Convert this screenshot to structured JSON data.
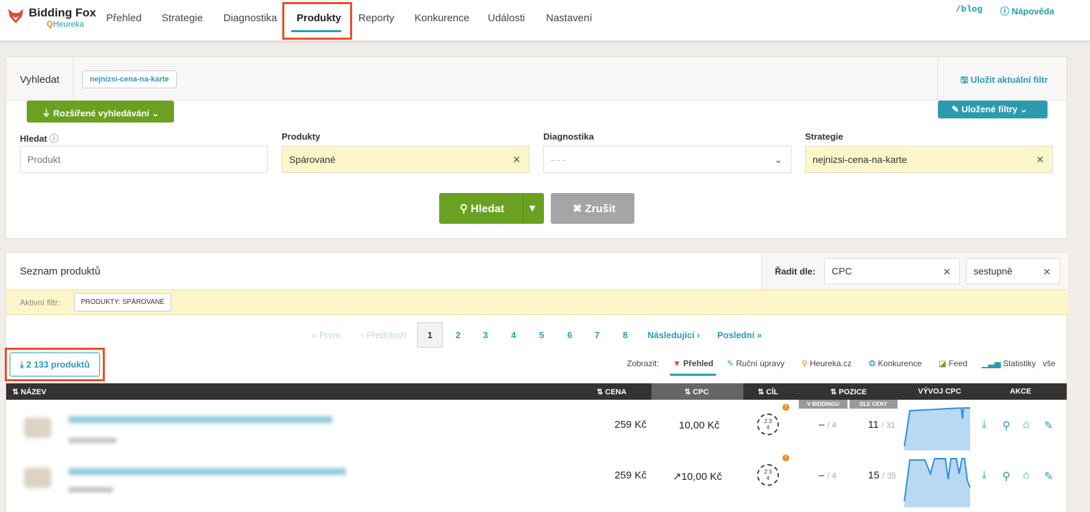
{
  "app": {
    "name": "Bidding Fox",
    "sub": "Heureka"
  },
  "nav": {
    "items": [
      "Přehled",
      "Strategie",
      "Diagnostika",
      "Produkty",
      "Reporty",
      "Konkurence",
      "Události",
      "Nastavení"
    ],
    "blog": "/blog",
    "help": "Nápověda"
  },
  "search": {
    "title": "Vyhledat",
    "tag": "nejnizsi-cena-na-karte",
    "save_filter": "Uložit aktuální filtr",
    "advanced": "Rozšířené vyhledávání",
    "saved_filters": "Uložené filtry",
    "labels": {
      "hledat": "Hledat",
      "produkty": "Produkty",
      "diagnostika": "Diagnostika",
      "strategie": "Strategie"
    },
    "product_placeholder": "Produkt",
    "produkty_value": "Spárované",
    "diagnostika_value": "- - -",
    "strategie_value": "nejnizsi-cena-na-karte",
    "search_btn": "Hledat",
    "cancel_btn": "Zrušit"
  },
  "list": {
    "title": "Seznam produktů",
    "sort_label": "Řadit dle:",
    "sort_value": "CPC",
    "sort_dir": "sestupně",
    "active_filter_label": "Aktivní filtr:",
    "active_filter": "PRODUKTY: SPÁROVANÉ",
    "count_btn": "2 133 produktů"
  },
  "pagination": {
    "first": "« První",
    "prev": "‹ Předchozí",
    "pages": [
      "1",
      "2",
      "3",
      "4",
      "5",
      "6",
      "7",
      "8"
    ],
    "current": "1",
    "next": "Následující ›",
    "last": "Poslední »"
  },
  "show": {
    "label": "Zobrazit:",
    "items": [
      "Přehled",
      "Ruční úpravy",
      "Heureka.cz",
      "Konkurence",
      "Feed",
      "Statistiky",
      "vše"
    ]
  },
  "table": {
    "headers": {
      "name": "NÁZEV",
      "price": "CENA",
      "cpc": "CPC",
      "goal": "CÍL",
      "position": "POZICE",
      "cpc_trend": "VÝVOJ CPC",
      "actions": "AKCE"
    },
    "subheaders": {
      "bidding": "V BIDDINGU",
      "by_price": "DLE CENY"
    },
    "rows": [
      {
        "price": "259 Kč",
        "cpc": "10,00 Kč",
        "goal": "2,3\n4",
        "bid_pos": "–",
        "bid_total": "/ 4",
        "price_pos": "11",
        "price_total": "/ 31"
      },
      {
        "price": "259 Kč",
        "cpc": "↗10,00 Kč",
        "goal": "2,3\n4",
        "bid_pos": "–",
        "bid_total": "/ 4",
        "price_pos": "15",
        "price_total": "/ 35"
      }
    ]
  },
  "colors": {
    "accent": "#2b9bb0",
    "green": "#6aa121",
    "highlight": "#f14a24",
    "yellow": "#fcf6c8"
  }
}
